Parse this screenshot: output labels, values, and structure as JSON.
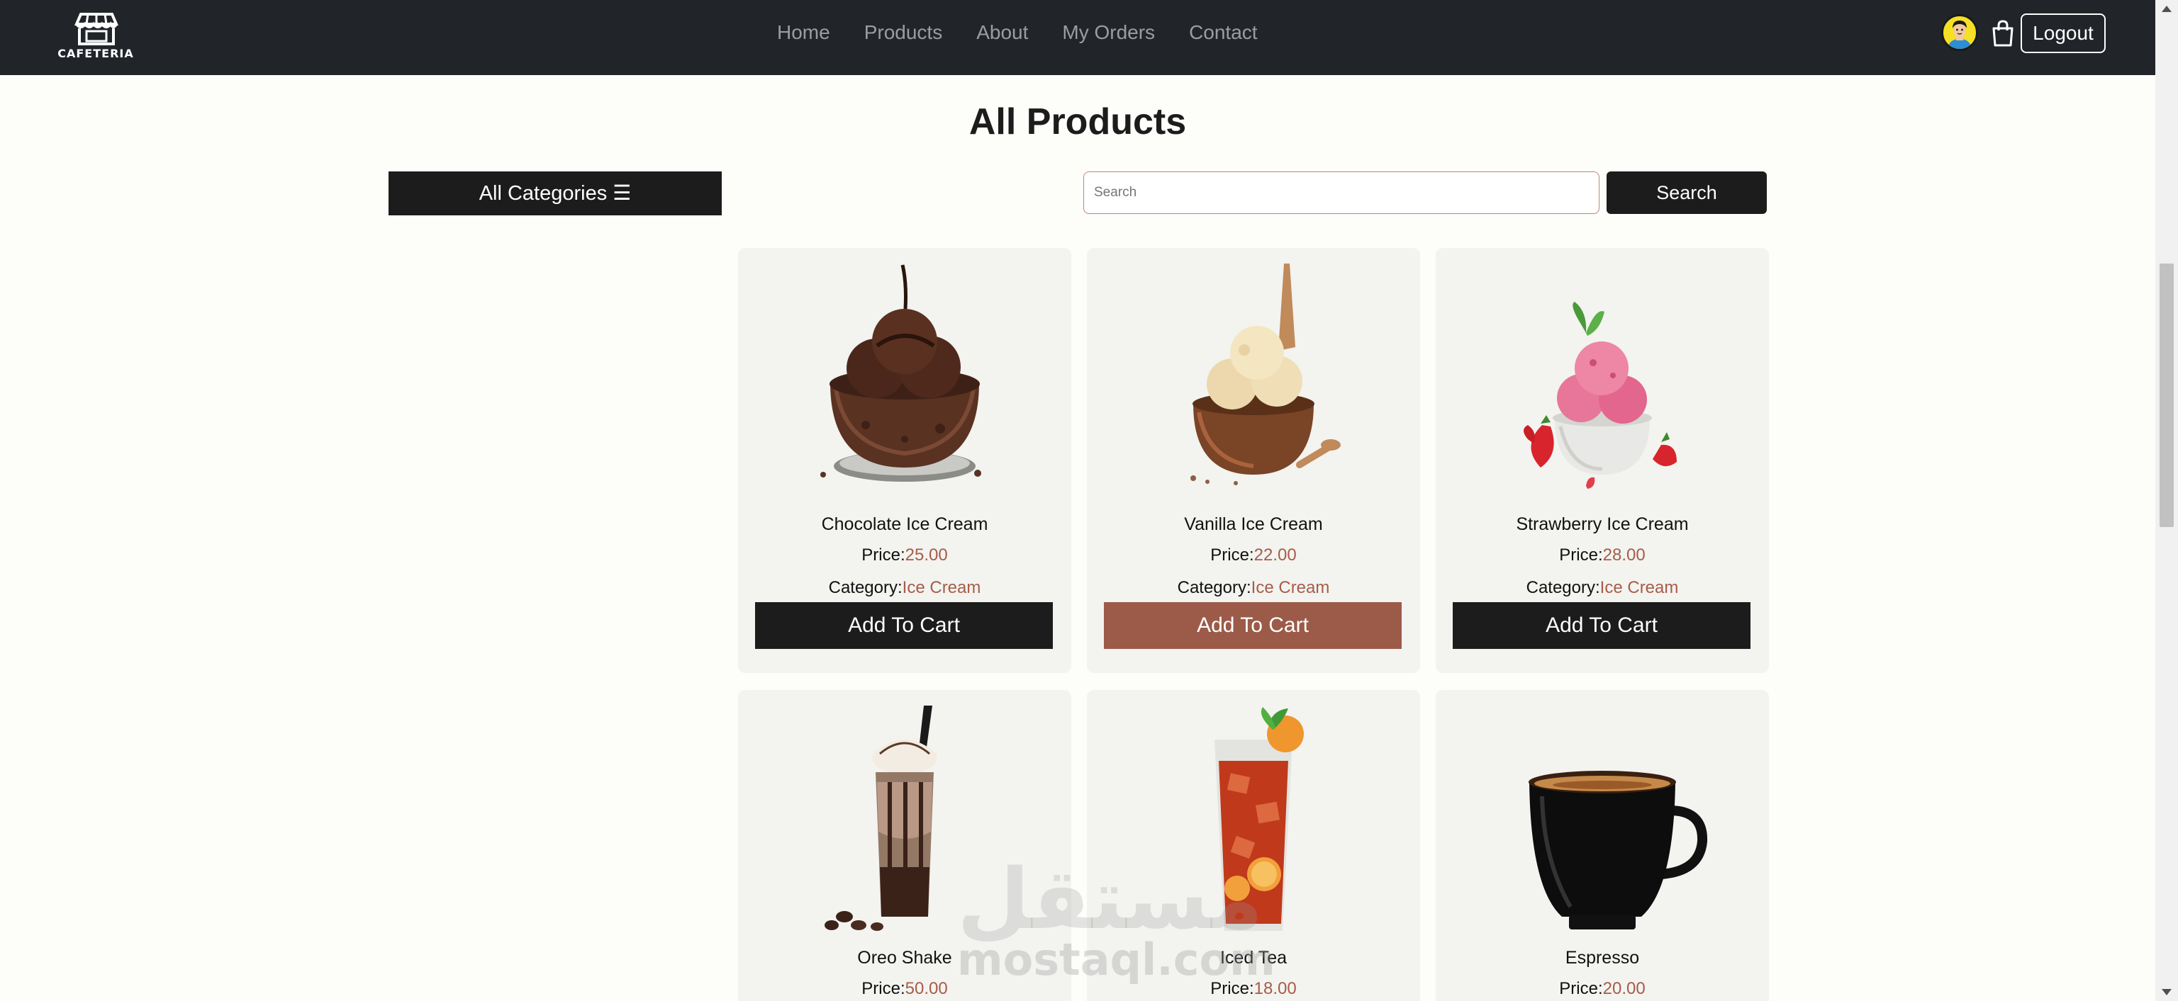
{
  "navbar": {
    "logo_text": "CAFETERIA",
    "links": [
      "Home",
      "Products",
      "About",
      "My Orders",
      "Contact"
    ],
    "logout_label": "Logout"
  },
  "page": {
    "title": "All Products",
    "category_button": "All Categories ☰",
    "search_placeholder": "Search",
    "search_button": "Search"
  },
  "labels": {
    "price": "Price:",
    "category": "Category:",
    "add_to_cart": "Add To Cart"
  },
  "products": [
    {
      "name": "Chocolate Ice Cream",
      "price": "25.00",
      "category": "Ice Cream",
      "image": "chocolate-ice-cream"
    },
    {
      "name": "Vanilla Ice Cream",
      "price": "22.00",
      "category": "Ice Cream",
      "image": "vanilla-ice-cream"
    },
    {
      "name": "Strawberry Ice Cream",
      "price": "28.00",
      "category": "Ice Cream",
      "image": "strawberry-ice-cream"
    },
    {
      "name": "Oreo Shake",
      "price": "50.00",
      "category": "",
      "image": "oreo-shake"
    },
    {
      "name": "Iced Tea",
      "price": "18.00",
      "category": "",
      "image": "iced-tea"
    },
    {
      "name": "Espresso",
      "price": "20.00",
      "category": "",
      "image": "espresso"
    }
  ],
  "watermark": {
    "arabic": "مستقل",
    "latin": "mostaql.com"
  },
  "colors": {
    "navbar": "#212529",
    "dark": "#1c1c1c",
    "accent": "#a65d48",
    "hover_button": "#9b5b48"
  }
}
